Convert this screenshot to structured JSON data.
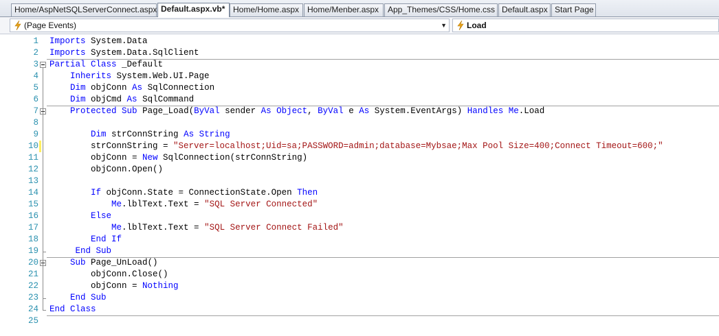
{
  "tabs": [
    {
      "label": "Home/AspNetSQLServerConnect.aspx",
      "active": false
    },
    {
      "label": "Default.aspx.vb*",
      "active": true
    },
    {
      "label": "Home/Home.aspx",
      "active": false
    },
    {
      "label": "Home/Menber.aspx",
      "active": false
    },
    {
      "label": "App_Themes/CSS/Home.css",
      "active": false
    },
    {
      "label": "Default.aspx",
      "active": false
    },
    {
      "label": "Start Page",
      "active": false
    }
  ],
  "navbar": {
    "left_combo": {
      "icon": "lightning-event-icon",
      "value": "(Page Events)"
    },
    "right_combo": {
      "icon": "lightning-event-icon",
      "value": "Load"
    }
  },
  "colors": {
    "keyword": "#0000ff",
    "string": "#a31515",
    "line_number": "#2b91af",
    "changed_unsaved": "#ffee62",
    "changed_saved": "#6cc26c"
  },
  "code_lines": [
    {
      "n": "1",
      "tokens": [
        [
          "kw",
          "Imports"
        ],
        [
          "t",
          " System.Data"
        ]
      ]
    },
    {
      "n": "2",
      "tokens": [
        [
          "kw",
          "Imports"
        ],
        [
          "t",
          " System.Data.SqlClient"
        ]
      ]
    },
    {
      "n": "3",
      "tokens": [
        [
          "kw",
          "Partial"
        ],
        [
          "t",
          " "
        ],
        [
          "kw",
          "Class"
        ],
        [
          "t",
          " _Default"
        ]
      ]
    },
    {
      "n": "4",
      "tokens": [
        [
          "t",
          "    "
        ],
        [
          "kw",
          "Inherits"
        ],
        [
          "t",
          " System.Web.UI.Page"
        ]
      ]
    },
    {
      "n": "5",
      "tokens": [
        [
          "t",
          "    "
        ],
        [
          "kw",
          "Dim"
        ],
        [
          "t",
          " objConn "
        ],
        [
          "kw",
          "As"
        ],
        [
          "t",
          " SqlConnection"
        ]
      ]
    },
    {
      "n": "6",
      "tokens": [
        [
          "t",
          "    "
        ],
        [
          "kw",
          "Dim"
        ],
        [
          "t",
          " objCmd "
        ],
        [
          "kw",
          "As"
        ],
        [
          "t",
          " SqlCommand"
        ]
      ]
    },
    {
      "n": "7",
      "tokens": [
        [
          "t",
          "    "
        ],
        [
          "kw",
          "Protected"
        ],
        [
          "t",
          " "
        ],
        [
          "kw",
          "Sub"
        ],
        [
          "t",
          " Page_Load("
        ],
        [
          "kw",
          "ByVal"
        ],
        [
          "t",
          " sender "
        ],
        [
          "kw",
          "As"
        ],
        [
          "t",
          " "
        ],
        [
          "kw",
          "Object"
        ],
        [
          "t",
          ", "
        ],
        [
          "kw",
          "ByVal"
        ],
        [
          "t",
          " e "
        ],
        [
          "kw",
          "As"
        ],
        [
          "t",
          " System.EventArgs) "
        ],
        [
          "kw",
          "Handles"
        ],
        [
          "t",
          " "
        ],
        [
          "kw",
          "Me"
        ],
        [
          "t",
          ".Load"
        ]
      ]
    },
    {
      "n": "8",
      "tokens": []
    },
    {
      "n": "9",
      "tokens": [
        [
          "t",
          "        "
        ],
        [
          "kw",
          "Dim"
        ],
        [
          "t",
          " strConnString "
        ],
        [
          "kw",
          "As"
        ],
        [
          "t",
          " "
        ],
        [
          "kw",
          "String"
        ]
      ]
    },
    {
      "n": "10",
      "tokens": [
        [
          "t",
          "        strConnString = "
        ],
        [
          "str",
          "\"Server=localhost;Uid=sa;PASSWORD=admin;database=Mybsae;Max Pool Size=400;Connect Timeout=600;\""
        ]
      ]
    },
    {
      "n": "11",
      "tokens": [
        [
          "t",
          "        objConn = "
        ],
        [
          "kw",
          "New"
        ],
        [
          "t",
          " SqlConnection(strConnString)"
        ]
      ]
    },
    {
      "n": "12",
      "tokens": [
        [
          "t",
          "        objConn.Open()"
        ]
      ]
    },
    {
      "n": "13",
      "tokens": []
    },
    {
      "n": "14",
      "tokens": [
        [
          "t",
          "        "
        ],
        [
          "kw",
          "If"
        ],
        [
          "t",
          " objConn.State = ConnectionState.Open "
        ],
        [
          "kw",
          "Then"
        ]
      ]
    },
    {
      "n": "15",
      "tokens": [
        [
          "t",
          "            "
        ],
        [
          "kw",
          "Me"
        ],
        [
          "t",
          ".lblText.Text = "
        ],
        [
          "str",
          "\"SQL Server Connected\""
        ]
      ]
    },
    {
      "n": "16",
      "tokens": [
        [
          "t",
          "        "
        ],
        [
          "kw",
          "Else"
        ]
      ]
    },
    {
      "n": "17",
      "tokens": [
        [
          "t",
          "            "
        ],
        [
          "kw",
          "Me"
        ],
        [
          "t",
          ".lblText.Text = "
        ],
        [
          "str",
          "\"SQL Server Connect Failed\""
        ]
      ]
    },
    {
      "n": "18",
      "tokens": [
        [
          "t",
          "        "
        ],
        [
          "kw",
          "End If"
        ]
      ]
    },
    {
      "n": "19",
      "tokens": [
        [
          "t",
          "     "
        ],
        [
          "kw",
          "End Sub"
        ]
      ]
    },
    {
      "n": "20",
      "tokens": [
        [
          "t",
          "    "
        ],
        [
          "kw",
          "Sub"
        ],
        [
          "t",
          " Page_UnLoad()"
        ]
      ]
    },
    {
      "n": "21",
      "tokens": [
        [
          "t",
          "        objConn.Close()"
        ]
      ]
    },
    {
      "n": "22",
      "tokens": [
        [
          "t",
          "        objConn = "
        ],
        [
          "kw",
          "Nothing"
        ]
      ]
    },
    {
      "n": "23",
      "tokens": [
        [
          "t",
          "    "
        ],
        [
          "kw",
          "End Sub"
        ]
      ]
    },
    {
      "n": "24",
      "tokens": [
        [
          "kw",
          "End Class"
        ]
      ]
    },
    {
      "n": "25",
      "tokens": []
    }
  ]
}
